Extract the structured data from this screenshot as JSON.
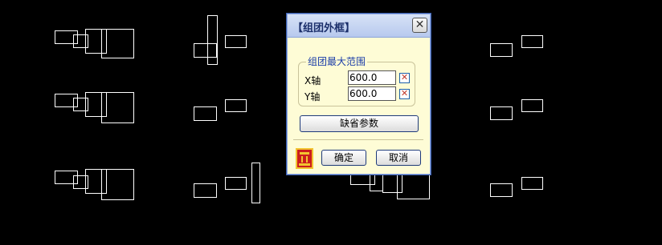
{
  "dialog": {
    "title": "【组团外框】",
    "close_glyph": "✕",
    "group": {
      "title": "组团最大范围",
      "x_label": "X轴",
      "x_value": "600.0",
      "y_label": "Y轴",
      "y_value": "600.0"
    },
    "default_button": "缺省参数",
    "ok_button": "确定",
    "cancel_button": "取消",
    "logo_icon": "app-logo-icon"
  },
  "colors": {
    "background": "#000000",
    "dialog_bg": "#fefcd6",
    "lines": "#ffffff"
  }
}
